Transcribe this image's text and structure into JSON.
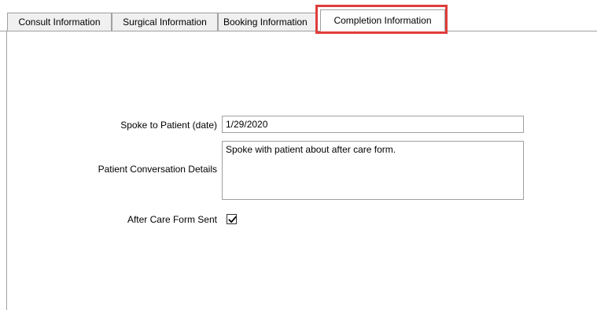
{
  "tabs": {
    "consult": "Consult Information",
    "surgical": "Surgical Information",
    "booking": "Booking Information",
    "completion": "Completion Information"
  },
  "form": {
    "spoke_label": "Spoke to Patient (date)",
    "spoke_value": "1/29/2020",
    "details_label": "Patient Conversation Details",
    "details_value": "Spoke with patient about after care form.",
    "aftercare_label": "After Care Form Sent",
    "aftercare_checked": true
  },
  "colors": {
    "highlight": "#e03c3c",
    "border": "#a0a0a0"
  },
  "icons": {
    "checkmark": "check-icon"
  }
}
